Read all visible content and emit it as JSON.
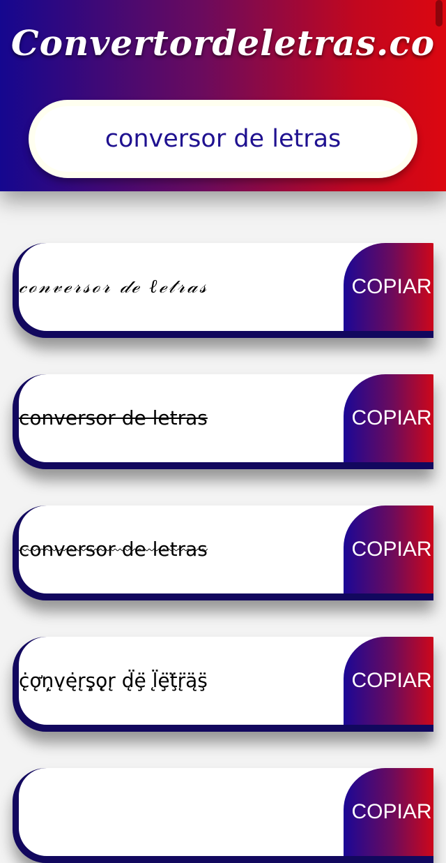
{
  "header": {
    "title": "Convertordeletras.co"
  },
  "search": {
    "value": "conversor de letras",
    "placeholder": ""
  },
  "results": [
    {
      "style": "script",
      "text": "𝒸ℴ𝓃𝓋ℯ𝓇𝓈ℴ𝓇 𝒹ℯ ℓℯ𝓉𝓇𝒶𝓈",
      "copy_label": "COPIAR"
    },
    {
      "style": "strikethrough",
      "text": "conversor de letras",
      "copy_label": "COPIAR"
    },
    {
      "style": "tilde-strikethrough",
      "text": "conversor de letras",
      "copy_label": "COPIAR"
    },
    {
      "style": "combining-marks",
      "text": "ċ̨ǫ̛ņ̨v̨ę̇r̨ş̨ǫ̨r̨ d̨̈ȩ̈ l̨̈ȩ̈ţ̈r̨̈ą̈ş̈",
      "copy_label": "COPIAR"
    },
    {
      "style": "partial",
      "text": "",
      "copy_label": "COPIAR"
    }
  ],
  "colors": {
    "gradient_start": "#15078f",
    "gradient_end": "#dc0710",
    "card_border": "#12085e",
    "search_text": "#1f1190"
  }
}
